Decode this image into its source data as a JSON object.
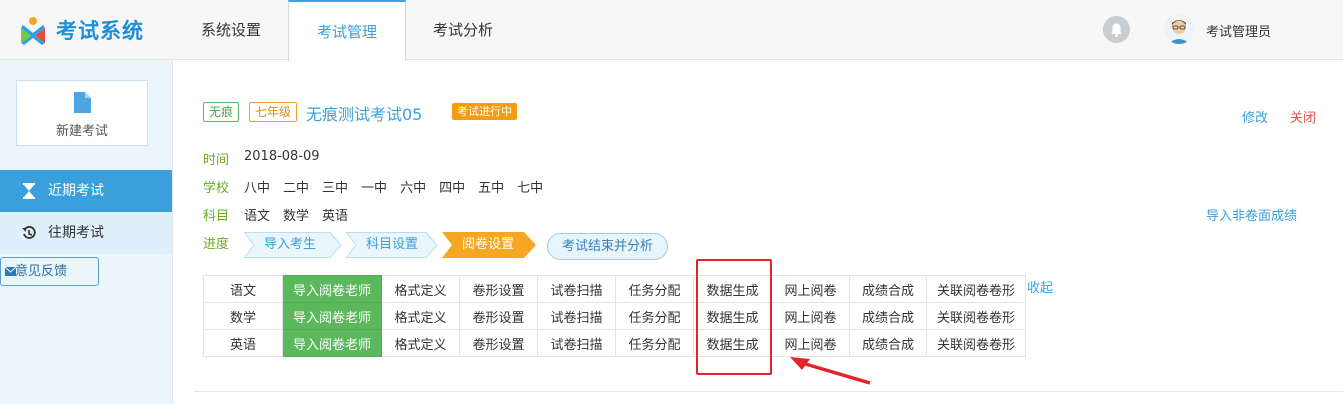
{
  "app": {
    "name": "考试系统"
  },
  "nav": {
    "tabs": [
      "系统设置",
      "考试管理",
      "考试分析"
    ],
    "active_index": 1
  },
  "user": {
    "name": "考试管理员"
  },
  "sidebar": {
    "new_exam": "新建考试",
    "items": [
      {
        "label": "近期考试",
        "active": true
      },
      {
        "label": "往期考试",
        "active": false
      }
    ],
    "feedback": "意见反馈"
  },
  "exam": {
    "tags": [
      "无痕",
      "七年级"
    ],
    "title": "无痕测试考试05",
    "status": "考试进行中",
    "actions": {
      "edit": "修改",
      "close": "关闭"
    },
    "time_label": "时间",
    "time_value": "2018-08-09",
    "school_label": "学校",
    "schools": [
      "八中",
      "二中",
      "三中",
      "一中",
      "六中",
      "四中",
      "五中",
      "七中"
    ],
    "subject_label": "科目",
    "subjects": [
      "语文",
      "数学",
      "英语"
    ],
    "progress_label": "进度",
    "steps": [
      {
        "label": "导入考生",
        "state": "done"
      },
      {
        "label": "科目设置",
        "state": "done"
      },
      {
        "label": "阅卷设置",
        "state": "current"
      }
    ],
    "finish_button": "考试结束并分析",
    "import_link": "导入非卷面成绩",
    "collapse_link": "收起"
  },
  "subject_table": {
    "rows": [
      {
        "subject": "语文",
        "cells": [
          "导入阅卷老师",
          "格式定义",
          "卷形设置",
          "试卷扫描",
          "任务分配",
          "数据生成",
          "网上阅卷",
          "成绩合成",
          "关联阅卷卷形"
        ]
      },
      {
        "subject": "数学",
        "cells": [
          "导入阅卷老师",
          "格式定义",
          "卷形设置",
          "试卷扫描",
          "任务分配",
          "数据生成",
          "网上阅卷",
          "成绩合成",
          "关联阅卷卷形"
        ]
      },
      {
        "subject": "英语",
        "cells": [
          "导入阅卷老师",
          "格式定义",
          "卷形设置",
          "试卷扫描",
          "任务分配",
          "数据生成",
          "网上阅卷",
          "成绩合成",
          "关联阅卷卷形"
        ]
      }
    ]
  },
  "colors": {
    "brand": "#1d8fd8",
    "accent": "#3a9fdd",
    "green": "#5cb85c",
    "orange": "#f39c12",
    "highlight": "#e4242a"
  }
}
